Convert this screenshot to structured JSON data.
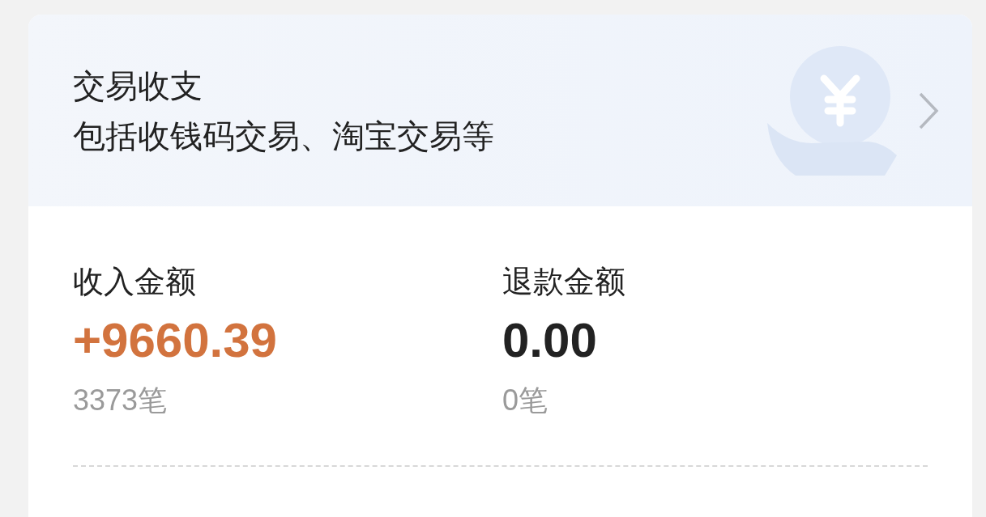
{
  "header": {
    "title": "交易收支",
    "subtitle": "包括收钱码交易、淘宝交易等"
  },
  "stats": [
    {
      "kind": "income",
      "label": "收入金额",
      "amount": "+9660.39",
      "count": "3373笔"
    },
    {
      "kind": "refund",
      "label": "退款金额",
      "amount": "0.00",
      "count": "0笔"
    }
  ]
}
